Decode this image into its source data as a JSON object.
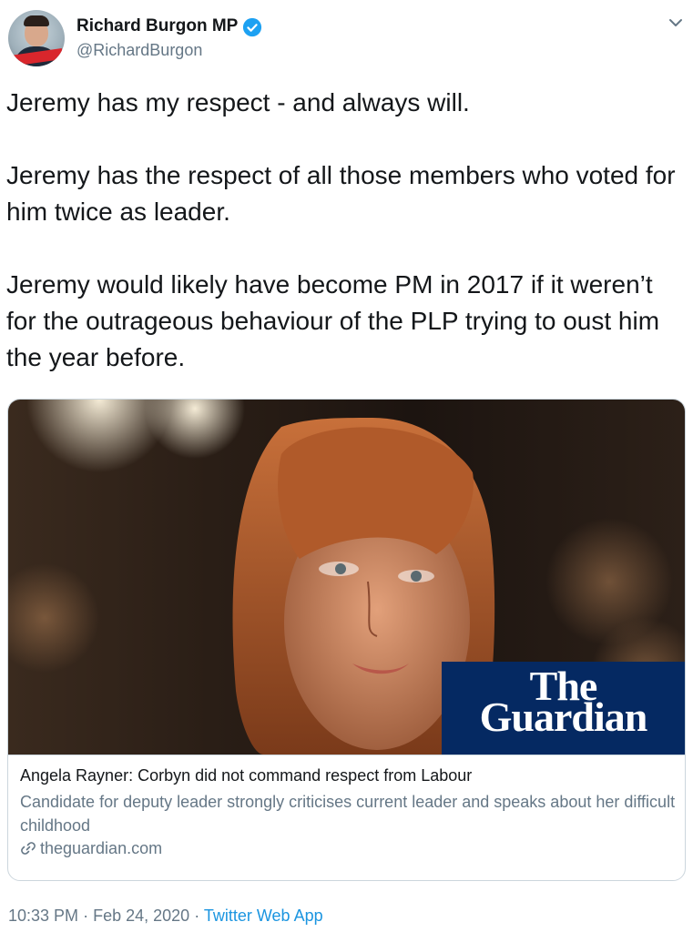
{
  "user": {
    "display_name": "Richard Burgon MP",
    "handle": "@RichardBurgon",
    "verified": true
  },
  "tweet": {
    "paragraphs": [
      "Jeremy has my respect - and always will.",
      "Jeremy has the respect of all those members who voted for him twice as leader.",
      "Jeremy would likely have become PM in 2017 if it weren’t for the outrageous behaviour of the PLP trying to oust him the year before."
    ]
  },
  "card": {
    "logo_line1": "The",
    "logo_line2": "Guardian",
    "title": "Angela Rayner: Corbyn did not command respect from Labour",
    "description": "Candidate for deputy leader strongly criticises current leader and speaks about her difficult childhood",
    "domain": "theguardian.com"
  },
  "meta": {
    "time": "10:33 PM",
    "separator": "·",
    "date": "Feb 24, 2020",
    "source": "Twitter Web App"
  },
  "icons": {
    "verified": "verified-badge-icon",
    "caret": "chevron-down-icon",
    "link": "link-icon"
  },
  "colors": {
    "accent": "#1b95e0",
    "verified": "#1da1f2",
    "muted": "#657786",
    "guardian_blue": "#052962"
  }
}
